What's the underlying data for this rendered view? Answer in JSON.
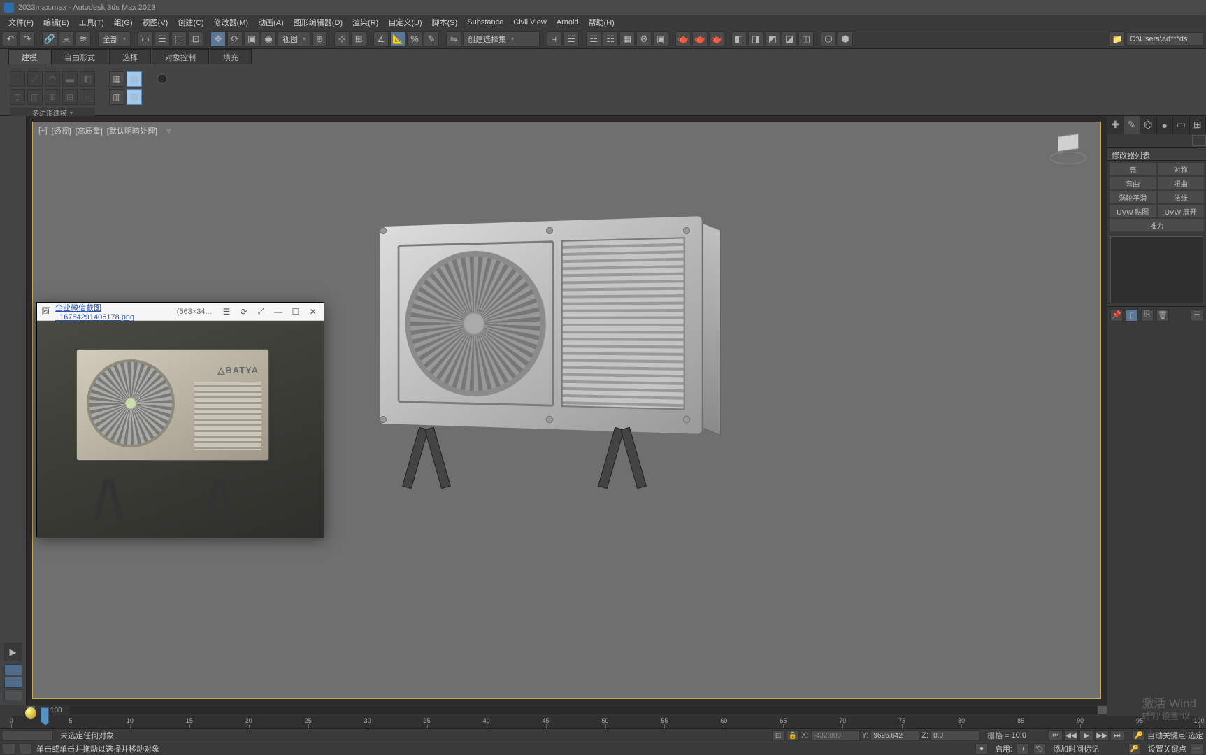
{
  "title": "2023max.max - Autodesk 3ds Max 2023",
  "menus": [
    "文件(F)",
    "编辑(E)",
    "工具(T)",
    "组(G)",
    "视图(V)",
    "创建(C)",
    "修改器(M)",
    "动画(A)",
    "图形编辑器(D)",
    "渲染(R)",
    "自定义(U)",
    "脚本(S)",
    "Substance",
    "Civil View",
    "Arnold",
    "帮助(H)"
  ],
  "toolbar": {
    "view_sel": "全部",
    "view_mode": "视图",
    "selset": "创建选择集",
    "path": "C:\\Users\\ad***ds"
  },
  "ribbon": {
    "tabs": [
      "建模",
      "自由形式",
      "选择",
      "对象控制",
      "填充"
    ],
    "caption": "多边形建模"
  },
  "viewport": {
    "menus": [
      "[+]",
      "[透视]",
      "[高质量]",
      "[默认明暗处理]"
    ]
  },
  "cmdpanel": {
    "section": "修改器列表",
    "rows": [
      [
        "壳",
        "对称"
      ],
      [
        "弯曲",
        "扭曲"
      ],
      [
        "涡轮平滑",
        "法线"
      ],
      [
        "UVW 贴图",
        "UVW 展开"
      ]
    ],
    "wide": "推力"
  },
  "refwin": {
    "title": "企业微信截图_16784291406178.png",
    "dims": "(563×34...",
    "brand": "△BATYA"
  },
  "hscroll": {
    "range": "0 / 100"
  },
  "timeline": {
    "start": 0,
    "end": 100,
    "step": 5
  },
  "status": {
    "selection": "未选定任何对象",
    "hint": "单击或单击并拖动以选择并移动对象",
    "x": "-432.803",
    "y": "9626.642",
    "z": "0.0",
    "grid": "10.0",
    "grid_label": "栅格 =",
    "enable": "启用:",
    "addtimetag": "添加时间标记",
    "autokey": "自动关键点",
    "setkey": "设置关键点",
    "sel_spin": "选定"
  },
  "watermark": {
    "l1": "激活 Wind",
    "l2": "转到\"设置\"以"
  }
}
